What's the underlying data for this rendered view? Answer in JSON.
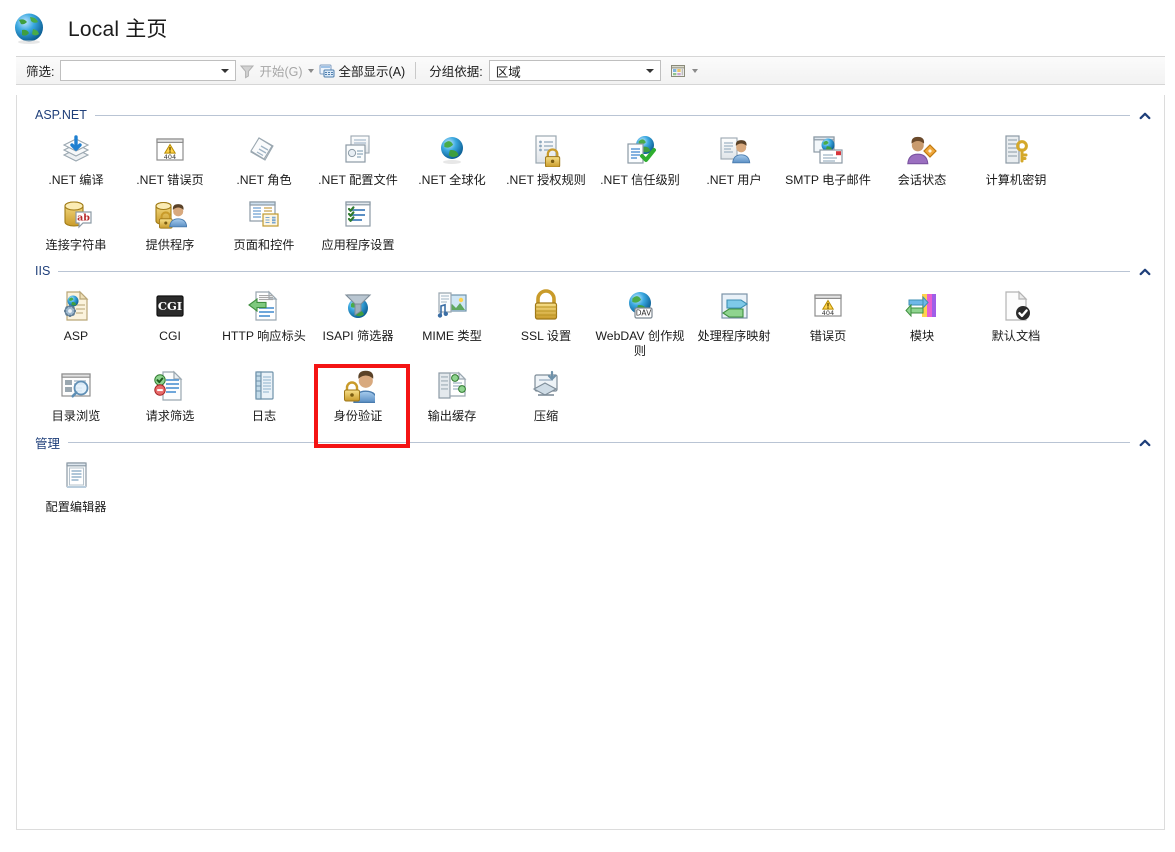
{
  "window": {
    "title": "Local 主页",
    "title_icon": "globe-icon"
  },
  "toolbar": {
    "filter_label": "筛选:",
    "filter_value": "",
    "filter_placeholder": "",
    "start_label": "开始(G)",
    "start_icon": "funnel-icon",
    "show_all_label": "全部显示(A)",
    "show_all_icon": "show-all-icon",
    "group_by_label": "分组依据:",
    "group_by_value": "区域",
    "view_icon": "view-mode-icon"
  },
  "groups": [
    {
      "name": "ASP.NET",
      "collapse_icon": "chevron-up-icon",
      "items": [
        {
          "label": ".NET 编译",
          "icon": "net-compilation-icon"
        },
        {
          "label": ".NET 错误页",
          "icon": "net-error-pages-icon"
        },
        {
          "label": ".NET 角色",
          "icon": "net-roles-icon"
        },
        {
          "label": ".NET 配置文件",
          "icon": "net-profile-icon"
        },
        {
          "label": ".NET 全球化",
          "icon": "net-globalization-icon"
        },
        {
          "label": ".NET 授权规则",
          "icon": "net-authorization-rules-icon"
        },
        {
          "label": ".NET 信任级别",
          "icon": "net-trust-levels-icon"
        },
        {
          "label": ".NET 用户",
          "icon": "net-users-icon"
        },
        {
          "label": "SMTP 电子邮件",
          "icon": "smtp-email-icon"
        },
        {
          "label": "会话状态",
          "icon": "session-state-icon"
        },
        {
          "label": "计算机密钥",
          "icon": "machine-key-icon"
        },
        {
          "label": "连接字符串",
          "icon": "connection-strings-icon"
        },
        {
          "label": "提供程序",
          "icon": "providers-icon"
        },
        {
          "label": "页面和控件",
          "icon": "pages-and-controls-icon"
        },
        {
          "label": "应用程序设置",
          "icon": "application-settings-icon"
        }
      ]
    },
    {
      "name": "IIS",
      "collapse_icon": "chevron-up-icon",
      "items": [
        {
          "label": "ASP",
          "icon": "asp-icon"
        },
        {
          "label": "CGI",
          "icon": "cgi-icon"
        },
        {
          "label": "HTTP 响应标头",
          "icon": "http-response-headers-icon"
        },
        {
          "label": "ISAPI 筛选器",
          "icon": "isapi-filters-icon"
        },
        {
          "label": "MIME 类型",
          "icon": "mime-types-icon"
        },
        {
          "label": "SSL 设置",
          "icon": "ssl-settings-icon"
        },
        {
          "label": "WebDAV 创作规则",
          "icon": "webdav-authoring-rules-icon"
        },
        {
          "label": "处理程序映射",
          "icon": "handler-mappings-icon"
        },
        {
          "label": "错误页",
          "icon": "error-pages-icon"
        },
        {
          "label": "模块",
          "icon": "modules-icon"
        },
        {
          "label": "默认文档",
          "icon": "default-document-icon"
        },
        {
          "label": "目录浏览",
          "icon": "directory-browsing-icon"
        },
        {
          "label": "请求筛选",
          "icon": "request-filtering-icon"
        },
        {
          "label": "日志",
          "icon": "logging-icon"
        },
        {
          "label": "身份验证",
          "icon": "authentication-icon",
          "highlighted": true
        },
        {
          "label": "输出缓存",
          "icon": "output-caching-icon"
        },
        {
          "label": "压缩",
          "icon": "compression-icon"
        }
      ]
    },
    {
      "name": "管理",
      "collapse_icon": "chevron-up-icon",
      "items": [
        {
          "label": "配置编辑器",
          "icon": "configuration-editor-icon"
        }
      ]
    }
  ],
  "colors": {
    "group_title": "#1f3f7a",
    "group_rule": "#b9c4d4",
    "highlight_box": "#f41414",
    "chevron": "#1f3f7a",
    "pane_border": "#dcdcdc"
  }
}
